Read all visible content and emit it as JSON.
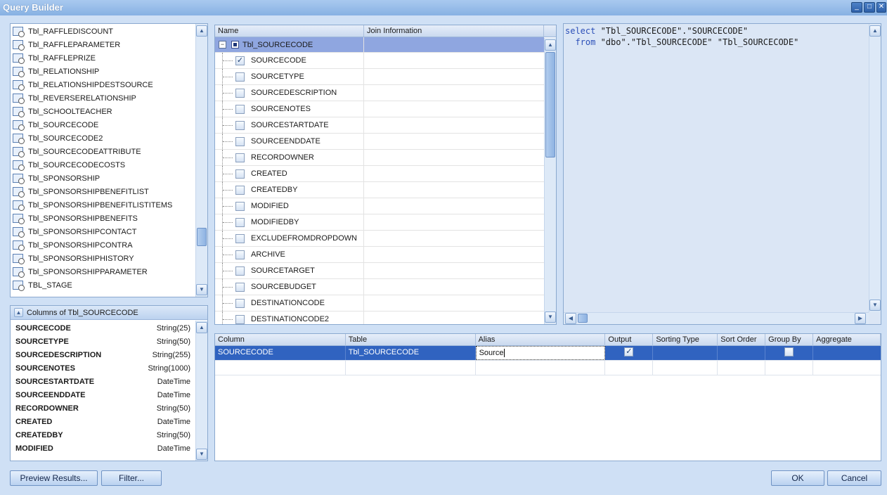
{
  "window": {
    "title": "Query Builder"
  },
  "tables": [
    "Tbl_RAFFLEDISCOUNT",
    "Tbl_RAFFLEPARAMETER",
    "Tbl_RAFFLEPRIZE",
    "Tbl_RELATIONSHIP",
    "Tbl_RELATIONSHIPDESTSOURCE",
    "Tbl_REVERSERELATIONSHIP",
    "Tbl_SCHOOLTEACHER",
    "Tbl_SOURCECODE",
    "Tbl_SOURCECODE2",
    "Tbl_SOURCECODEATTRIBUTE",
    "Tbl_SOURCECODECOSTS",
    "Tbl_SPONSORSHIP",
    "Tbl_SPONSORSHIPBENEFITLIST",
    "Tbl_SPONSORSHIPBENEFITLISTITEMS",
    "Tbl_SPONSORSHIPBENEFITS",
    "Tbl_SPONSORSHIPCONTACT",
    "Tbl_SPONSORSHIPCONTRA",
    "Tbl_SPONSORSHIPHISTORY",
    "Tbl_SPONSORSHIPPARAMETER",
    "TBL_STAGE"
  ],
  "columns_panel": {
    "title": "Columns of Tbl_SOURCECODE",
    "rows": [
      {
        "name": "SOURCECODE",
        "type": "String(25)"
      },
      {
        "name": "SOURCETYPE",
        "type": "String(50)"
      },
      {
        "name": "SOURCEDESCRIPTION",
        "type": "String(255)"
      },
      {
        "name": "SOURCENOTES",
        "type": "String(1000)"
      },
      {
        "name": "SOURCESTARTDATE",
        "type": "DateTime"
      },
      {
        "name": "SOURCEENDDATE",
        "type": "DateTime"
      },
      {
        "name": "RECORDOWNER",
        "type": "String(50)"
      },
      {
        "name": "CREATED",
        "type": "DateTime"
      },
      {
        "name": "CREATEDBY",
        "type": "String(50)"
      },
      {
        "name": "MODIFIED",
        "type": "DateTime"
      }
    ]
  },
  "tree": {
    "headers": {
      "name": "Name",
      "join": "Join Information"
    },
    "root": "Tbl_SOURCECODE",
    "fields": [
      {
        "label": "SOURCECODE",
        "checked": true
      },
      {
        "label": "SOURCETYPE",
        "checked": false
      },
      {
        "label": "SOURCEDESCRIPTION",
        "checked": false
      },
      {
        "label": "SOURCENOTES",
        "checked": false
      },
      {
        "label": "SOURCESTARTDATE",
        "checked": false
      },
      {
        "label": "SOURCEENDDATE",
        "checked": false
      },
      {
        "label": "RECORDOWNER",
        "checked": false
      },
      {
        "label": "CREATED",
        "checked": false
      },
      {
        "label": "CREATEDBY",
        "checked": false
      },
      {
        "label": "MODIFIED",
        "checked": false
      },
      {
        "label": "MODIFIEDBY",
        "checked": false
      },
      {
        "label": "EXCLUDEFROMDROPDOWN",
        "checked": false
      },
      {
        "label": "ARCHIVE",
        "checked": false
      },
      {
        "label": "SOURCETARGET",
        "checked": false
      },
      {
        "label": "SOURCEBUDGET",
        "checked": false
      },
      {
        "label": "DESTINATIONCODE",
        "checked": false
      },
      {
        "label": "DESTINATIONCODE2",
        "checked": false
      }
    ]
  },
  "sql": {
    "kw_select": "select",
    "line1": " \"Tbl_SOURCECODE\".\"SOURCECODE\"",
    "kw_from": "from",
    "line2": " \"dbo\".\"Tbl_SOURCECODE\" \"Tbl_SOURCECODE\""
  },
  "grid": {
    "headers": [
      "Column",
      "Table",
      "Alias",
      "Output",
      "Sorting Type",
      "Sort Order",
      "Group By",
      "Aggregate"
    ],
    "row": {
      "column": "SOURCECODE",
      "table": "Tbl_SOURCECODE",
      "alias": "Source",
      "output": true,
      "group_by": false
    }
  },
  "buttons": {
    "preview": "Preview Results...",
    "filter": "Filter...",
    "ok": "OK",
    "cancel": "Cancel"
  },
  "colors": {
    "accent": "#3063c0",
    "title": "#87b1e3"
  }
}
